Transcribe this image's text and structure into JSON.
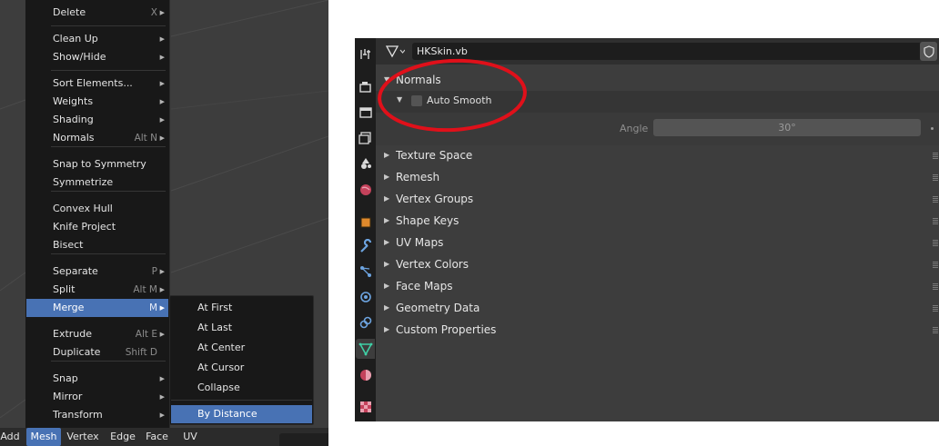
{
  "viewport_menu": {
    "items": [
      {
        "label": "Delete",
        "shortcut": "X",
        "submenu": true
      },
      {
        "label": "Clean Up",
        "shortcut": "",
        "submenu": true
      },
      {
        "label": "Show/Hide",
        "shortcut": "",
        "submenu": true
      },
      {
        "label": "Sort Elements...",
        "shortcut": "",
        "submenu": true
      },
      {
        "label": "Weights",
        "shortcut": "",
        "submenu": true
      },
      {
        "label": "Shading",
        "shortcut": "",
        "submenu": true
      },
      {
        "label": "Normals",
        "shortcut": "Alt N",
        "submenu": true
      },
      {
        "label": "Snap to Symmetry",
        "shortcut": "",
        "submenu": false
      },
      {
        "label": "Symmetrize",
        "shortcut": "",
        "submenu": false
      },
      {
        "label": "Convex Hull",
        "shortcut": "",
        "submenu": false
      },
      {
        "label": "Knife Project",
        "shortcut": "",
        "submenu": false
      },
      {
        "label": "Bisect",
        "shortcut": "",
        "submenu": false
      },
      {
        "label": "Separate",
        "shortcut": "P",
        "submenu": true
      },
      {
        "label": "Split",
        "shortcut": "Alt M",
        "submenu": true
      },
      {
        "label": "Merge",
        "shortcut": "M",
        "submenu": true,
        "active": true
      },
      {
        "label": "Extrude",
        "shortcut": "Alt E",
        "submenu": true
      },
      {
        "label": "Duplicate",
        "shortcut": "Shift D",
        "submenu": false
      },
      {
        "label": "Snap",
        "shortcut": "",
        "submenu": true
      },
      {
        "label": "Mirror",
        "shortcut": "",
        "submenu": true
      },
      {
        "label": "Transform",
        "shortcut": "",
        "submenu": true
      }
    ]
  },
  "merge_submenu": {
    "items": [
      "At First",
      "At Last",
      "At Center",
      "At Cursor",
      "Collapse",
      "By Distance"
    ],
    "active": "By Distance"
  },
  "header_menu": [
    "Add",
    "Mesh",
    "Vertex",
    "Edge",
    "Face",
    "UV"
  ],
  "header_active": "Mesh",
  "properties": {
    "data_name": "HKSkin.vb",
    "panels": {
      "normals": "Normals",
      "auto_smooth": "Auto Smooth",
      "auto_smooth_checked": false,
      "angle_label": "Angle",
      "angle_value": "30°"
    },
    "collapsed_panels": [
      "Texture Space",
      "Remesh",
      "Vertex Groups",
      "Shape Keys",
      "UV Maps",
      "Vertex Colors",
      "Face Maps",
      "Geometry Data",
      "Custom Properties"
    ],
    "tab_icons": [
      "tool-icon",
      "render-icon",
      "output-icon",
      "view-layer-icon",
      "scene-icon",
      "world-icon",
      "object-icon",
      "modifier-icon",
      "particles-icon",
      "physics-icon",
      "constraints-icon",
      "object-data-icon",
      "material-icon",
      "texture-icon"
    ],
    "active_tab": "object-data-icon"
  },
  "colors": {
    "highlight": "#4872b4",
    "annotation": "#e0101a",
    "data_green": "#3fd0a6"
  }
}
